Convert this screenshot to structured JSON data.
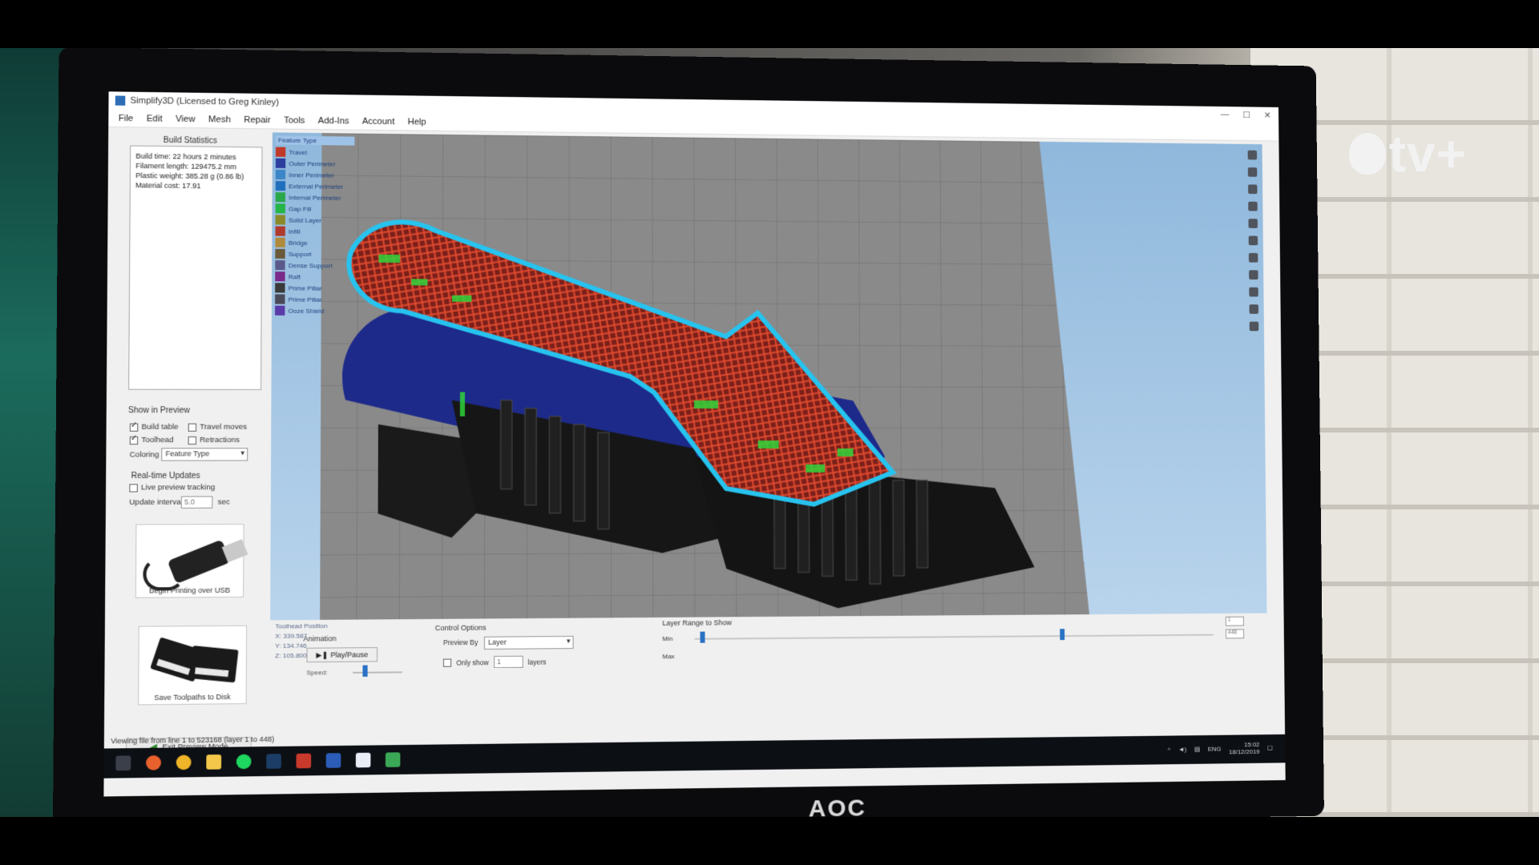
{
  "window": {
    "title": "Simplify3D (Licensed to Greg Kinley)"
  },
  "menu": [
    "File",
    "Edit",
    "View",
    "Mesh",
    "Repair",
    "Tools",
    "Add-Ins",
    "Account",
    "Help"
  ],
  "build_stats": {
    "title": "Build Statistics",
    "lines": [
      "Build time: 22 hours 2 minutes",
      "Filament length: 129475.2 mm",
      "Plastic weight: 385.28 g (0.86 lb)",
      "Material cost: 17.91"
    ]
  },
  "show_in_preview": {
    "title": "Show in Preview",
    "build_table": "Build table",
    "travel_moves": "Travel moves",
    "toolhead": "Toolhead",
    "retractions": "Retractions",
    "coloring_label": "Coloring",
    "coloring_value": "Feature Type"
  },
  "realtime": {
    "title": "Real-time Updates",
    "preview_tracking": "Live preview tracking",
    "interval_label": "Update interval",
    "interval_value": "5.0",
    "interval_unit": "sec"
  },
  "cards": {
    "usb": "Begin Printing over USB",
    "sd": "Save Toolpaths to Disk"
  },
  "exit_preview": "Exit Preview Mode",
  "legend": {
    "title": "Feature Type",
    "items": [
      {
        "label": "Travel",
        "color": "#c0392b"
      },
      {
        "label": "Outer Perimeter",
        "color": "#2c3e9e"
      },
      {
        "label": "Inner Perimeter",
        "color": "#3b86c7"
      },
      {
        "label": "External Perimeter",
        "color": "#1f6fbd"
      },
      {
        "label": "Internal Perimeter",
        "color": "#2aa84a"
      },
      {
        "label": "Gap Fill",
        "color": "#26b548"
      },
      {
        "label": "Solid Layer",
        "color": "#8a8a2a"
      },
      {
        "label": "Infill",
        "color": "#b03a2e"
      },
      {
        "label": "Bridge",
        "color": "#b08a3c"
      },
      {
        "label": "Support",
        "color": "#6a5a3a"
      },
      {
        "label": "Dense Support",
        "color": "#5a5a8a"
      },
      {
        "label": "Raft",
        "color": "#7a2a8a"
      },
      {
        "label": "Prime Pillar",
        "color": "#3a3a3a"
      },
      {
        "label": "Prime Pillar",
        "color": "#4a4a5a"
      },
      {
        "label": "Ooze Shield",
        "color": "#5a3aa8"
      }
    ]
  },
  "toolhead_position": {
    "title": "Toolhead Position",
    "x": "X: 339.587",
    "y": "Y: 134.746",
    "z": "Z: 105.800"
  },
  "animation": {
    "title": "Animation",
    "play_pause": "Play/Pause",
    "speed_label": "Speed:"
  },
  "control_options": {
    "title": "Control Options",
    "preview_by_label": "Preview By",
    "preview_by_value": "Layer",
    "only_show": "Only show",
    "only_show_value": "1",
    "layers": "layers"
  },
  "layer_range": {
    "title": "Layer Range to Show",
    "min_label": "Min",
    "max_label": "Max",
    "min_value": 0.01,
    "max_value": 0.7,
    "box_top": "1",
    "box_bottom": "448"
  },
  "status_bar": "Viewing file from line 1 to 523168 (layer 1 to 448)",
  "taskbar": {
    "lang": "ENG",
    "time": "15:02",
    "date": "18/12/2019"
  },
  "monitor_brand": "AOC",
  "overlay_logo": "tv+"
}
